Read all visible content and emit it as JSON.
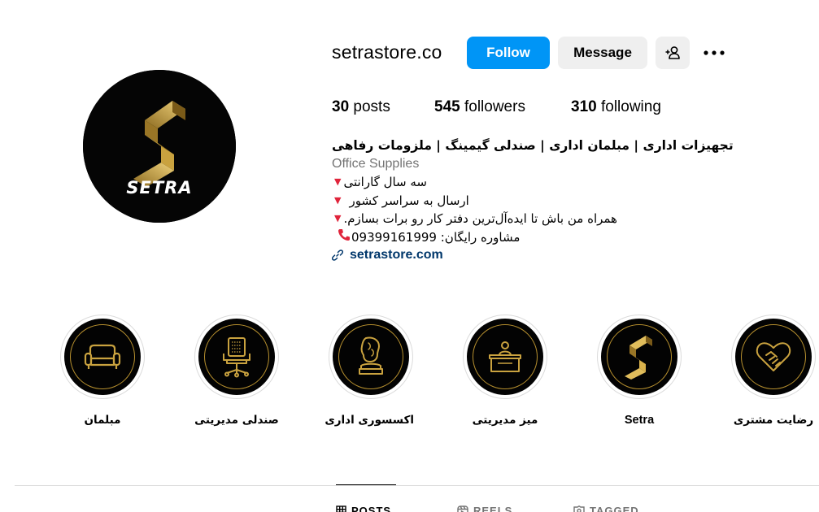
{
  "profile": {
    "username": "setrastore.co",
    "follow_label": "Follow",
    "message_label": "Message",
    "avatar_logo_text": "SETRA"
  },
  "stats": {
    "posts_count": "30",
    "posts_label": "posts",
    "followers_count": "545",
    "followers_label": "followers",
    "following_count": "310",
    "following_label": "following"
  },
  "bio": {
    "title": "تجهیزات اداری | مبلمان اداری | صندلی گیمینگ | ملزومات رفاهی",
    "category": "Office Supplies",
    "line1": "سه سال گارانتی",
    "line2": "ارسال به سراسر کشور",
    "line3": "همراه من باش تا ایده‌آل‌ترین دفتر کار رو برات بسازم.",
    "line4": "مشاوره رایگان: 09399161999",
    "link": "setrastore.com"
  },
  "highlights": [
    {
      "label": "مبلمان",
      "icon": "sofa-icon"
    },
    {
      "label": "صندلی مدیریتی",
      "icon": "office-chair-icon"
    },
    {
      "label": "اکسسوری اداری",
      "icon": "bust-statue-icon"
    },
    {
      "label": "میز مدیریتی",
      "icon": "desk-icon"
    },
    {
      "label": "Setra",
      "icon": "setra-logo-icon"
    },
    {
      "label": "رضایت مشتری",
      "icon": "handshake-heart-icon"
    }
  ],
  "tabs": [
    {
      "label": "POSTS",
      "icon": "grid-icon",
      "active": true
    },
    {
      "label": "REELS",
      "icon": "reels-icon",
      "active": false
    },
    {
      "label": "TAGGED",
      "icon": "tagged-icon",
      "active": false
    }
  ],
  "colors": {
    "follow_button": "#0095f6",
    "secondary_button": "#efefef",
    "link": "#00376b",
    "gold_accent": "#b8912f",
    "bullet_red": "#e0243b"
  }
}
